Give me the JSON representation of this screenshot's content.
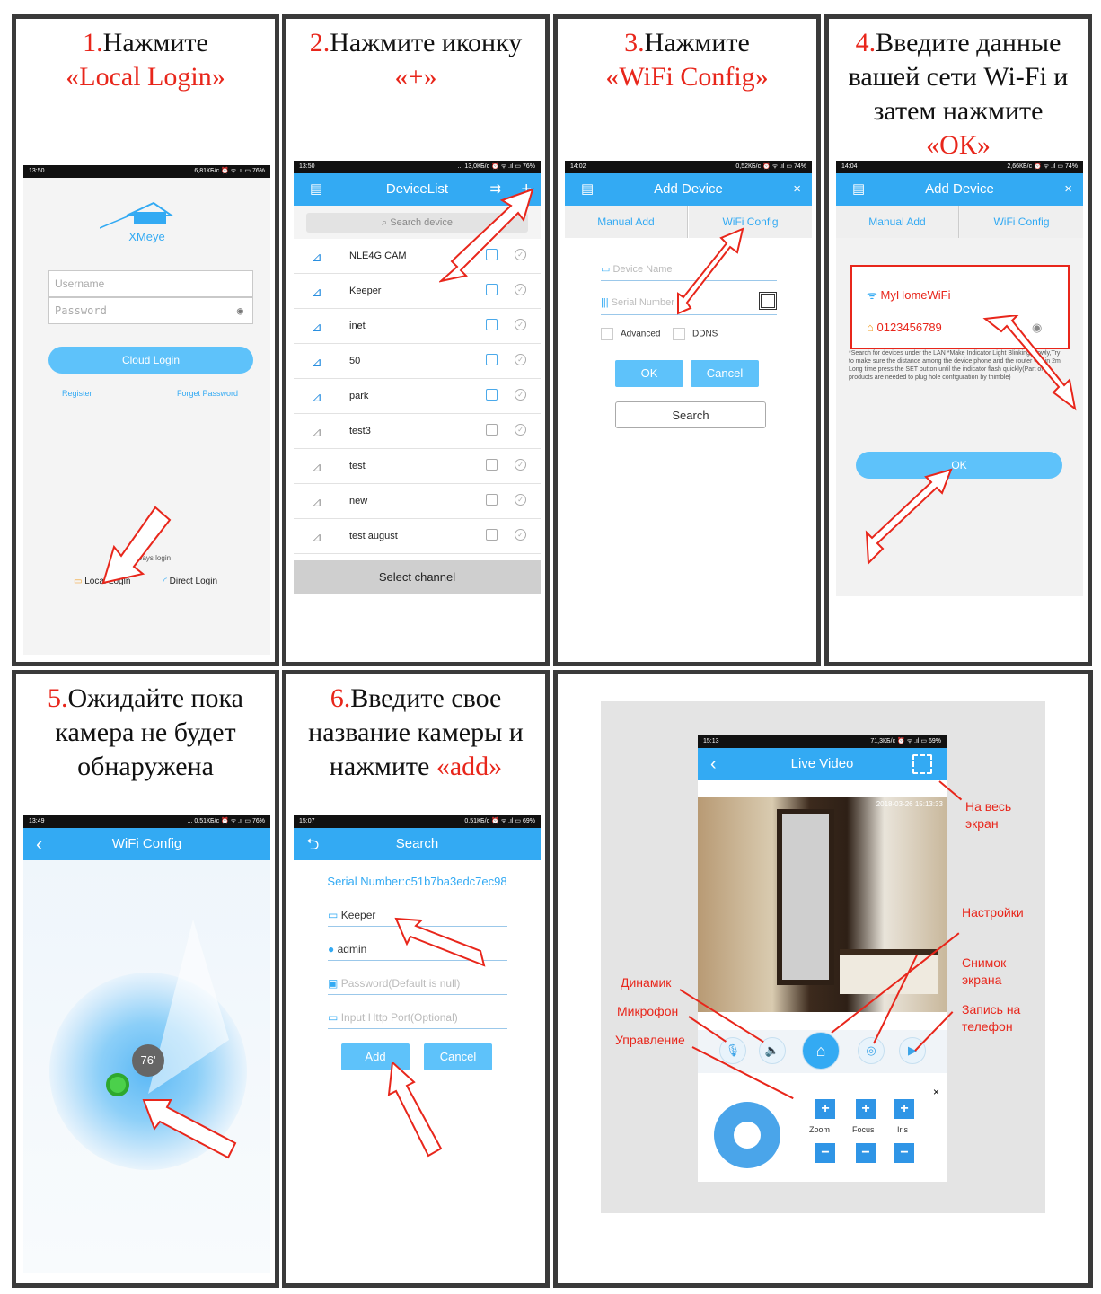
{
  "steps": [
    {
      "num": "1.",
      "pre": "Нажмите",
      "hl": "«Local Login»",
      "post": ""
    },
    {
      "num": "2.",
      "pre": "Нажмите иконку",
      "hl": "«+»",
      "post": ""
    },
    {
      "num": "3.",
      "pre": "Нажмите",
      "hl": "«WiFi Config»",
      "post": ""
    },
    {
      "num": "4.",
      "pre": "Введите данные вашей сети Wi-Fi и затем нажмите",
      "hl": "«ОК»",
      "post": ""
    },
    {
      "num": "5.",
      "pre": "Ожидайте пока камера не будет обнаружена",
      "hl": "",
      "post": ""
    },
    {
      "num": "6.",
      "pre": "Введите свое название камеры и нажмите",
      "hl": "«add»",
      "post": ""
    }
  ],
  "login": {
    "time": "13:50",
    "status": "... 6,81КБ/с ⏰ ᯤ .ıl ▭ 76%",
    "app": "XMeye",
    "username_ph": "Username",
    "password_ph": "Password",
    "cloud": "Cloud Login",
    "register": "Register",
    "forget": "Forget Password",
    "other": "Other Ways login",
    "local": "Local Login",
    "direct": "Direct Login"
  },
  "devlist": {
    "time": "13:50",
    "status": "... 13,0КБ/с ⏰ ᯤ .ıl ▭ 76%",
    "title": "DeviceList",
    "search_ph": "Search device",
    "select": "Select channel",
    "items": [
      "NLE4G CAM",
      "Keeper",
      "inet",
      "50",
      "park",
      "test3",
      "test",
      "new",
      "test august"
    ]
  },
  "adddev": {
    "time": "14:02",
    "status": "0,52КБ/с ⏰ ᯤ .ıl ▭ 74%",
    "title": "Add Device",
    "tab1": "Manual Add",
    "tab2": "WiFi Config",
    "name_ph": "Device Name",
    "serial_ph": "Serial Number",
    "advanced": "Advanced",
    "ddns": "DDNS",
    "ok": "OK",
    "cancel": "Cancel",
    "search": "Search"
  },
  "wifi": {
    "time": "14:04",
    "status": "2,66КБ/с ⏰ ᯤ .ıl ▭ 74%",
    "title": "Add Device",
    "tab1": "Manual Add",
    "tab2": "WiFi Config",
    "ssid": "MyHomeWiFi",
    "pass": "0123456789",
    "hint": "*Search for devices under the LAN *Make Indicator Light Blinking Slowly,Try to make sure the distance among the device,phone and the router within 2m Long time press the SET button until the indicator flash quickly(Part of products are needed to plug hole configuration by thimble)",
    "ok": "OK"
  },
  "scan": {
    "time": "13:49",
    "status": "... 0,51КБ/с ⏰ ᯤ .ıl ▭ 76%",
    "title": "WiFi Config",
    "progress": "76'"
  },
  "searchpg": {
    "time": "15:07",
    "status": "0,51КБ/с ⏰ ᯤ .ıl ▭ 69%",
    "title": "Search",
    "serial": "Serial Number:c51b7ba3edc7ec98",
    "name": "Keeper",
    "user": "admin",
    "pass_ph": "Password(Default is null)",
    "port_ph": "Input Http Port(Optional)",
    "add": "Add",
    "cancel": "Cancel"
  },
  "live": {
    "time": "15:13",
    "status": "71,3КБ/с ⏰ ᯤ .ıl ▭ 69%",
    "title": "Live Video",
    "stamp": "2018-03-26 15:13:33",
    "zoom": "Zoom",
    "focus": "Focus",
    "iris": "Iris",
    "ann_full": "На весь экран",
    "ann_settings": "Настройки",
    "ann_shot": "Снимок экрана",
    "ann_rec": "Запись на телефон",
    "ann_speaker": "Динамик",
    "ann_mic": "Микрофон",
    "ann_ctrl": "Управление"
  },
  "colors": {
    "accent": "#33aaf3",
    "highlight": "#e8261b",
    "border": "#3a3a3a"
  }
}
